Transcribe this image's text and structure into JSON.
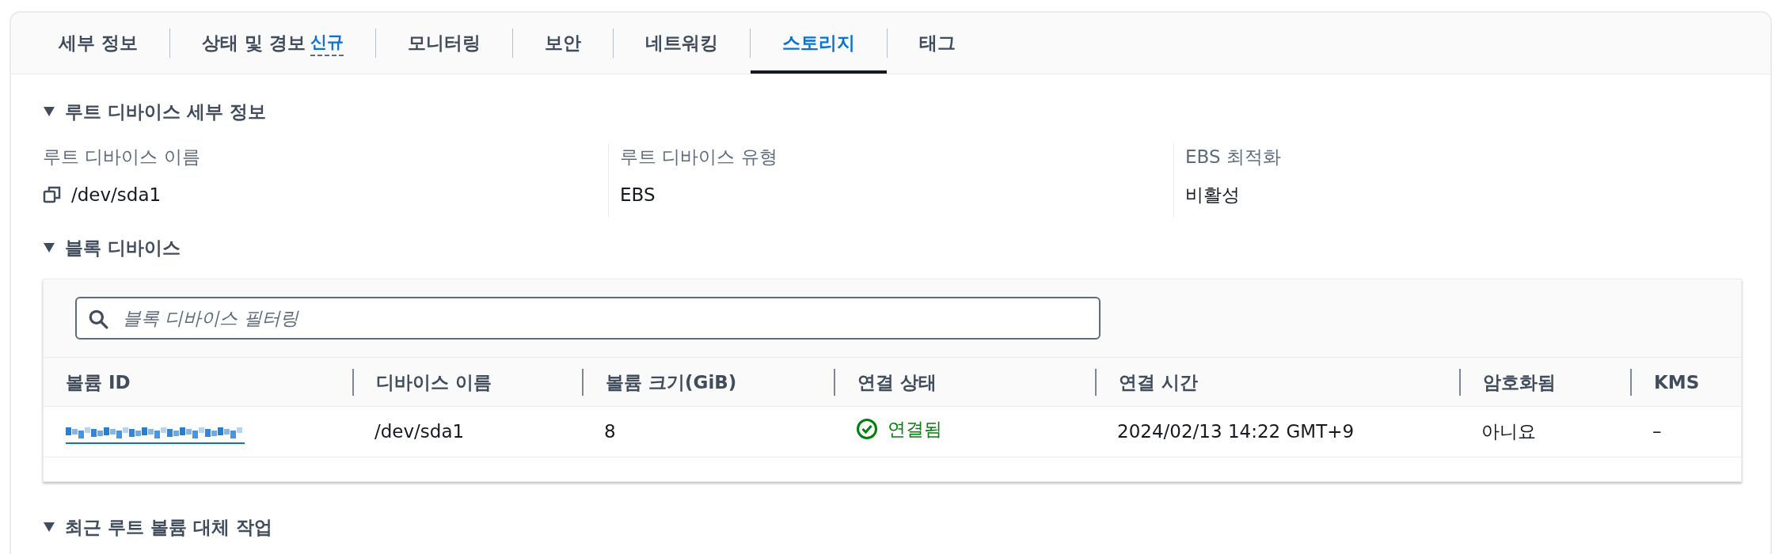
{
  "tabs": [
    {
      "label": "세부 정보",
      "selected": false
    },
    {
      "label": "상태 및 경보",
      "badge": "신규",
      "selected": false
    },
    {
      "label": "모니터링",
      "selected": false
    },
    {
      "label": "보안",
      "selected": false
    },
    {
      "label": "네트워킹",
      "selected": false
    },
    {
      "label": "스토리지",
      "selected": true
    },
    {
      "label": "태그",
      "selected": false
    }
  ],
  "root_device_section": {
    "title": "루트 디바이스 세부 정보",
    "expanded": true,
    "fields": [
      {
        "label": "루트 디바이스 이름",
        "value": "/dev/sda1",
        "copyable": true
      },
      {
        "label": "루트 디바이스 유형",
        "value": "EBS",
        "copyable": false
      },
      {
        "label": "EBS 최적화",
        "value": "비활성",
        "copyable": false
      }
    ]
  },
  "block_device_section": {
    "title": "블록 디바이스",
    "expanded": true,
    "search": {
      "placeholder": "블록 디바이스 필터링"
    },
    "table": {
      "columns": [
        "볼륨 ID",
        "디바이스 이름",
        "볼륨 크기(GiB)",
        "연결 상태",
        "연결 시간",
        "암호화됨",
        "KMS"
      ],
      "rows": [
        {
          "volume_id": {
            "kind": "redacted"
          },
          "device_name": "/dev/sda1",
          "size": "8",
          "status": {
            "text": "연결됨",
            "kind": "success"
          },
          "attach_time": "2024/02/13 14:22 GMT+9",
          "encrypted": "아니요",
          "kms": "–"
        }
      ]
    }
  },
  "next_section": {
    "title": "최근 루트 볼륨 대체 작업",
    "expanded": true
  }
}
